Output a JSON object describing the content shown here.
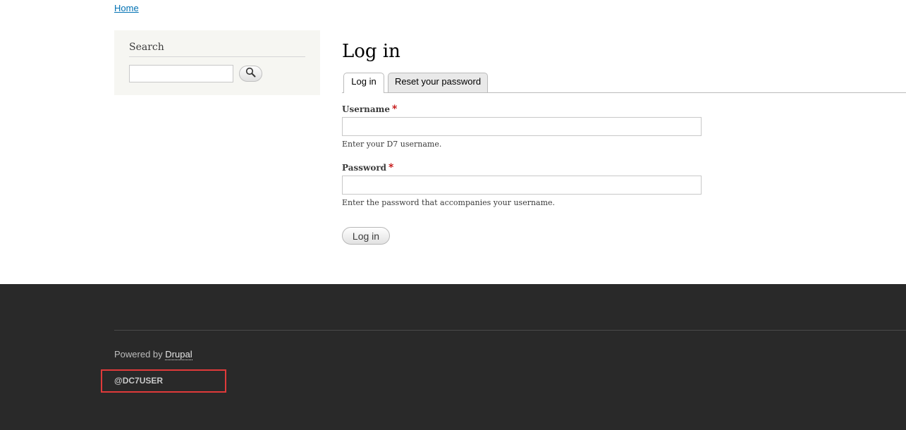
{
  "breadcrumb": {
    "home": "Home"
  },
  "sidebar": {
    "search_title": "Search",
    "search_value": "",
    "search_icon": "magnifier-icon"
  },
  "main": {
    "title": "Log in",
    "tabs": [
      {
        "label": "Log in",
        "active": true
      },
      {
        "label": "Reset your password",
        "active": false
      }
    ],
    "username": {
      "label": "Username",
      "required_mark": "*",
      "value": "",
      "description": "Enter your D7 username."
    },
    "password": {
      "label": "Password",
      "required_mark": "*",
      "value": "",
      "description": "Enter the password that accompanies your username."
    },
    "submit_label": "Log in"
  },
  "footer": {
    "powered_prefix": "Powered by",
    "powered_link": "Drupal",
    "user_handle": "@DC7USER"
  },
  "colors": {
    "link": "#0071b3",
    "required": "#c00000",
    "footer_bg": "#292929",
    "highlight": "#e03a3a"
  }
}
